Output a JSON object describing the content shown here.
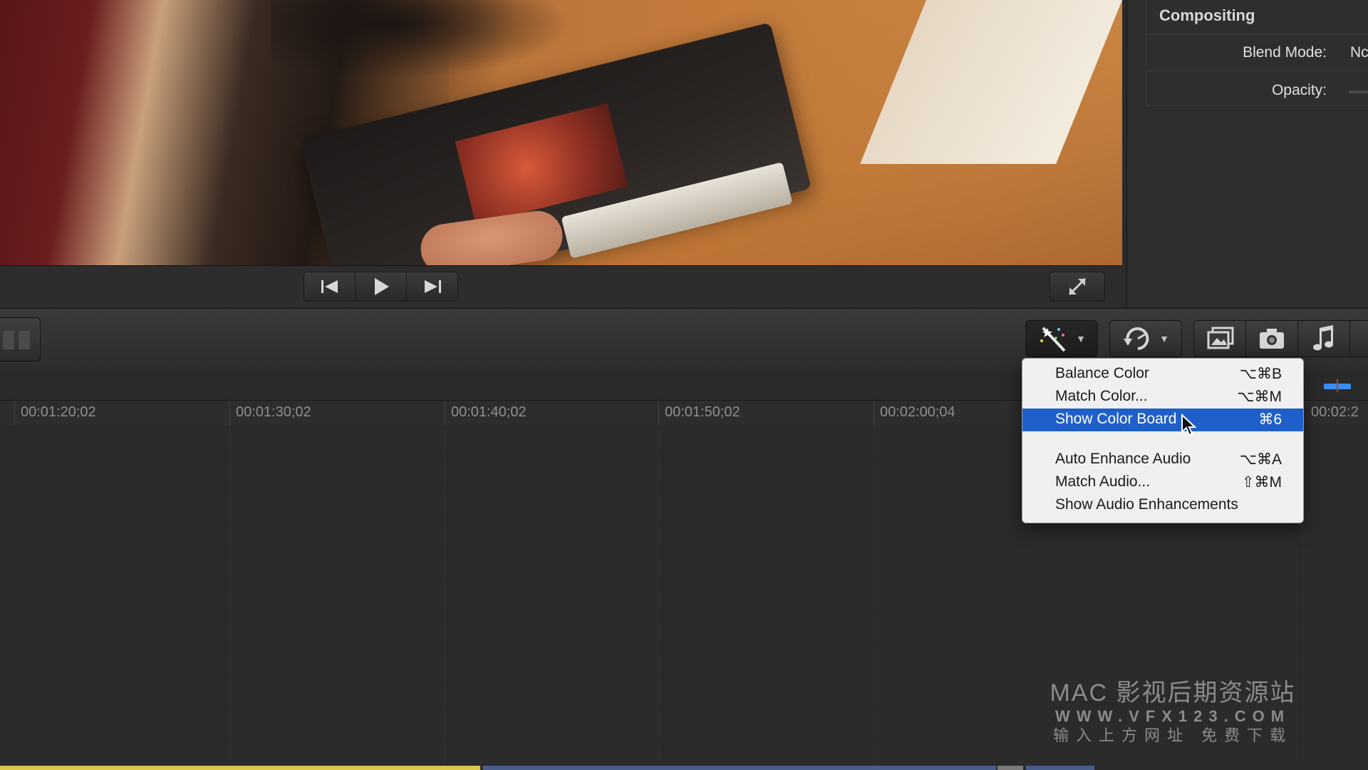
{
  "inspector": {
    "section_title": "Compositing",
    "blend_mode_label": "Blend Mode:",
    "blend_mode_value": "Nc",
    "opacity_label": "Opacity:"
  },
  "timeline": {
    "timecodes": [
      "00:01:20;02",
      "00:01:30;02",
      "00:01:40;02",
      "00:01:50;02",
      "00:02:00;04",
      "00:02:2"
    ]
  },
  "enhance_menu": {
    "items": [
      {
        "label": "Balance Color",
        "shortcut": "⌥⌘B"
      },
      {
        "label": "Match Color...",
        "shortcut": "⌥⌘M"
      },
      {
        "label": "Show Color Board",
        "shortcut": "⌘6"
      },
      {
        "label": "Auto Enhance Audio",
        "shortcut": "⌥⌘A"
      },
      {
        "label": "Match Audio...",
        "shortcut": "⇧⌘M"
      },
      {
        "label": "Show Audio Enhancements",
        "shortcut": ""
      }
    ],
    "highlighted": "Show Color Board"
  },
  "watermark": {
    "line1": "MAC 影视后期资源站",
    "line2": "WWW.VFX123.COM",
    "line3": "输入上方网址 免费下载"
  },
  "icons": [
    "go-to-start-icon",
    "play-icon",
    "go-to-end-icon",
    "fullscreen-icon",
    "enhance-wand-icon",
    "retime-icon",
    "photo-browser-icon",
    "camera-icon",
    "music-icon"
  ],
  "colors": {
    "menu_highlight": "#1f5fc9",
    "playhead": "#3a8df0"
  }
}
